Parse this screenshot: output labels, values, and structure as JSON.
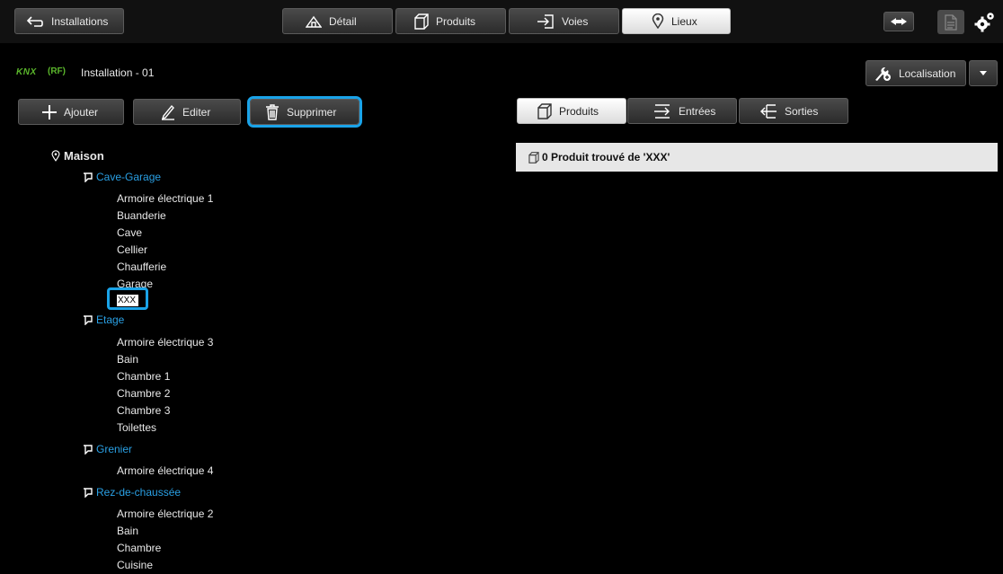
{
  "topbar": {
    "back_label": "Installations",
    "tabs": [
      {
        "label": "Détail"
      },
      {
        "label": "Produits"
      },
      {
        "label": "Voies"
      },
      {
        "label": "Lieux"
      }
    ]
  },
  "installation": {
    "knx_logo": "KNX",
    "rf_logo": "(RF)",
    "title": "Installation - 01"
  },
  "localisation_label": "Localisation",
  "toolbar": {
    "add_label": "Ajouter",
    "edit_label": "Editer",
    "delete_label": "Supprimer"
  },
  "right_tabs": {
    "produits": "Produits",
    "entrees": "Entrées",
    "sorties": "Sorties"
  },
  "results_text": "0 Produit trouvé de 'XXX'",
  "tree": {
    "root": "Maison",
    "floors": [
      {
        "name": "Cave-Garage",
        "rooms": [
          "Armoire électrique 1",
          "Buanderie",
          "Cave",
          "Cellier",
          "Chaufferie",
          "Garage"
        ],
        "editing": "XXX"
      },
      {
        "name": "Etage",
        "rooms": [
          "Armoire électrique 3",
          "Bain",
          "Chambre 1",
          "Chambre 2",
          "Chambre 3",
          "Toilettes"
        ]
      },
      {
        "name": "Grenier",
        "rooms": [
          "Armoire électrique 4"
        ]
      },
      {
        "name": "Rez-de-chaussée",
        "rooms": [
          "Armoire électrique 2",
          "Bain",
          "Chambre",
          "Cuisine"
        ]
      }
    ]
  },
  "colors": {
    "accent": "#1aa3e8",
    "floor_link": "#2aa0e4",
    "knx_green": "#5ab52b"
  }
}
